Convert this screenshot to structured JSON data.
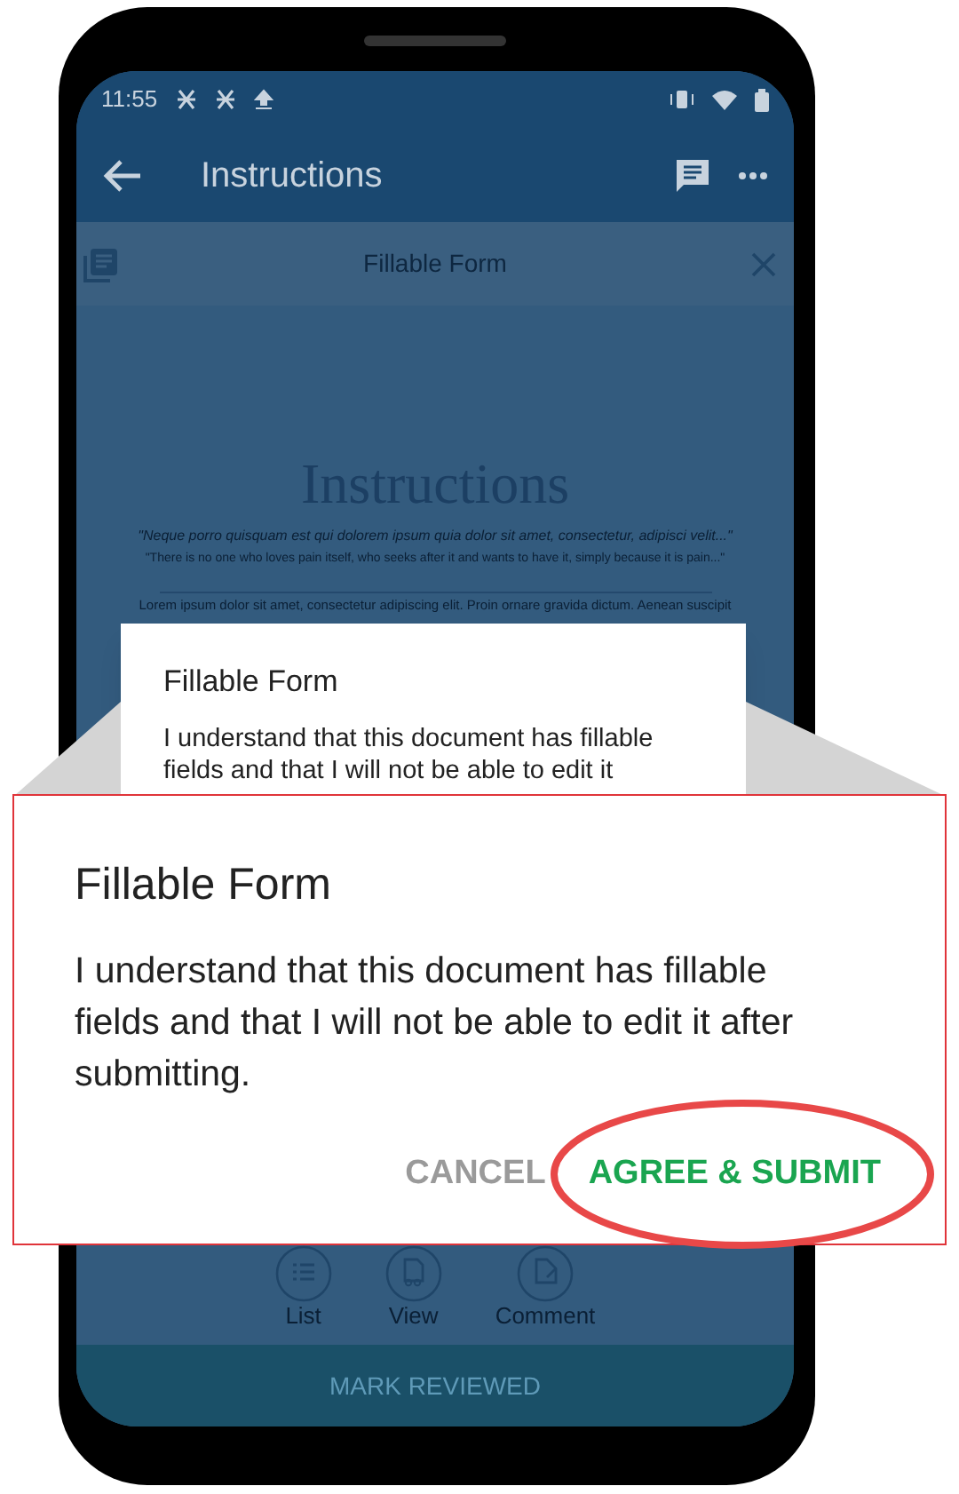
{
  "status_bar": {
    "time": "11:55"
  },
  "app_bar": {
    "title": "Instructions"
  },
  "doc_toolbar": {
    "title": "Fillable Form"
  },
  "document": {
    "heading": "Instructions",
    "quote": "\"Neque porro quisquam est qui dolorem ipsum quia dolor sit amet, consectetur, adipisci velit...\"",
    "translation": "\"There is no one who loves pain itself, who seeks after it and wants to have it, simply because it is pain...\"",
    "body": "Lorem ipsum dolor sit amet, consectetur adipiscing elit. Proin ornare gravida dictum. Aenean suscipit"
  },
  "dialog": {
    "title": "Fillable Form",
    "message": "I understand that this document has fillable fields and that I will not be able to edit it"
  },
  "callout": {
    "title": "Fillable Form",
    "message": "I understand that this document has fillable fields and that I will not be able to edit it after submitting.",
    "buttons": [
      {
        "label": "CANCEL",
        "kind": "secondary",
        "highlighted": false
      },
      {
        "label": "AGREE & SUBMIT",
        "kind": "primary",
        "highlighted": true
      }
    ]
  },
  "bottom_nav": [
    {
      "label": "List",
      "kind": "list"
    },
    {
      "label": "View",
      "kind": "view"
    },
    {
      "label": "Comment",
      "kind": "comment"
    }
  ],
  "mark_reviewed": "MARK REVIEWED"
}
